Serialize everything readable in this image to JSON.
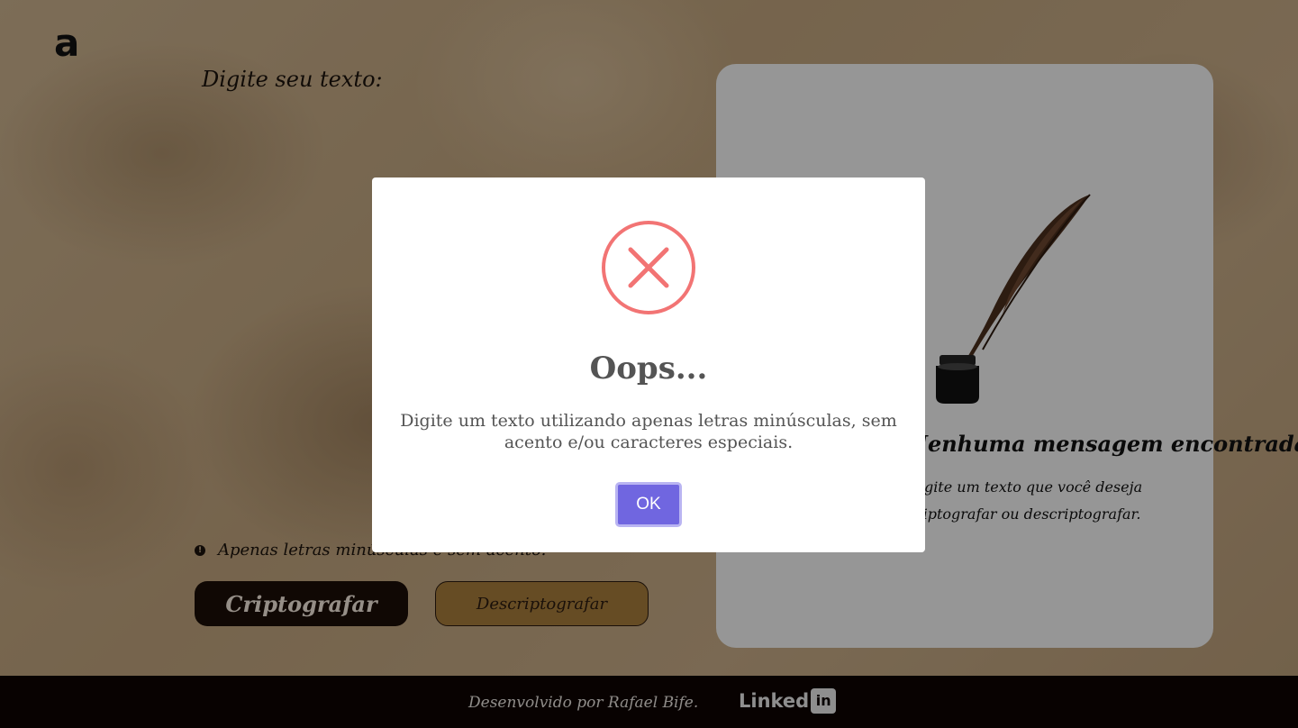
{
  "app": {
    "logo_text": "a"
  },
  "input": {
    "label": "Digite seu texto:",
    "hint_icon": "!",
    "hint": "Apenas letras minúsculas e sem acento."
  },
  "buttons": {
    "encrypt": "Criptografar",
    "decrypt": "Descriptografar"
  },
  "output": {
    "title": "Nenhuma mensagem encontrada",
    "description": "Digite um texto que você deseja criptografar ou descriptografar."
  },
  "footer": {
    "credit": "Desenvolvido por Rafael Bife.",
    "linkedin_text": "Linked",
    "linkedin_box": "in"
  },
  "modal": {
    "title": "Oops...",
    "message": "Digite um texto utilizando apenas letras minúsculas, sem acento e/ou caracteres especiais.",
    "ok_label": "OK",
    "icon": "error-x-icon",
    "icon_color": "#f27474",
    "button_color": "#7066e0"
  }
}
